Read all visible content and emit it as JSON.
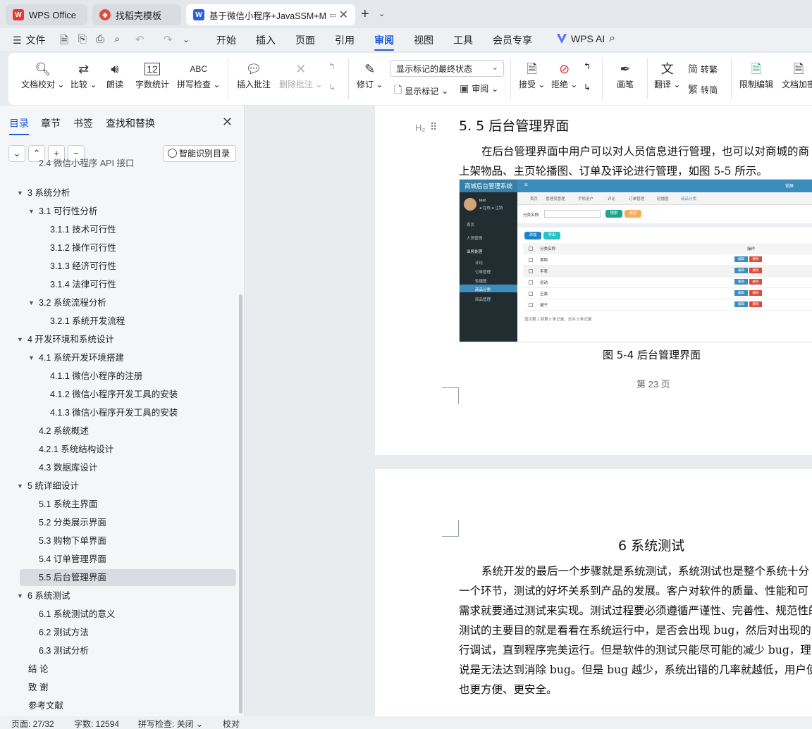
{
  "tabs": [
    {
      "label": "WPS Office",
      "icon": "wps-logo-icon"
    },
    {
      "label": "找稻壳模板",
      "icon": "docer-icon"
    },
    {
      "label": "基于微信小程序+JavaSSM+M",
      "icon": "word-doc-icon",
      "active": true
    }
  ],
  "menu": {
    "file": "文件",
    "tabs": [
      "开始",
      "插入",
      "页面",
      "引用",
      "审阅",
      "视图",
      "工具",
      "会员专享"
    ],
    "active_tab": "审阅",
    "wps_ai": "WPS AI"
  },
  "ribbon": {
    "proofread": "文档校对",
    "compare": "比较",
    "read_aloud": "朗读",
    "word_count": "字数统计",
    "spell_check": "拼写检查",
    "spell_check_icon_text": "ABC",
    "word_count_icon_text": "12",
    "insert_comment": "插入批注",
    "delete_comment": "删除批注",
    "track_changes": "修订",
    "markup_mode": "显示标记的最终状态",
    "show_markup": "显示标记",
    "review": "审阅",
    "accept": "接受",
    "reject": "拒绝",
    "ink": "画笔",
    "translate": "翻译",
    "trad_convert": "转繁",
    "simp_convert": "转简",
    "restrict_edit": "限制编辑",
    "doc_encrypt": "文档加密"
  },
  "sidebar": {
    "tabs": [
      "目录",
      "章节",
      "书签",
      "查找和替换"
    ],
    "active_tab": "目录",
    "smart_toc": "智能识别目录",
    "items": [
      {
        "label": "2.4 微信小程序 API 接口",
        "level": 2
      },
      {
        "label": "3  系统分析",
        "level": 1,
        "expanded": true
      },
      {
        "label": "3.1  可行性分析",
        "level": 2,
        "expanded": true
      },
      {
        "label": "3.1.1  技术可行性",
        "level": 3
      },
      {
        "label": "3.1.2 操作可行性",
        "level": 3
      },
      {
        "label": "3.1.3  经济可行性",
        "level": 3
      },
      {
        "label": "3.1.4  法律可行性",
        "level": 3
      },
      {
        "label": "3.2 系统流程分析",
        "level": 2,
        "expanded": true
      },
      {
        "label": "3.2.1 系统开发流程",
        "level": 3
      },
      {
        "label": "4  开发环境和系统设计",
        "level": 1,
        "expanded": true
      },
      {
        "label": "4.1 系统开发环境搭建",
        "level": 2,
        "expanded": true
      },
      {
        "label": "4.1.1    微信小程序的注册",
        "level": 3
      },
      {
        "label": "4.1.2  微信小程序开发工具的安装",
        "level": 3
      },
      {
        "label": "4.1.3  微信小程序开发工具的安装",
        "level": 3
      },
      {
        "label": "4.2  系统概述",
        "level": 2
      },
      {
        "label": "4.2.1  系统结构设计",
        "level": 2
      },
      {
        "label": "4.3 数据库设计",
        "level": 2
      },
      {
        "label": "5 统详细设计",
        "level": 1,
        "expanded": true
      },
      {
        "label": "5.1 系统主界面",
        "level": 2
      },
      {
        "label": "5.2 分类展示界面",
        "level": 2
      },
      {
        "label": "5.3 购物下单界面",
        "level": 2
      },
      {
        "label": "5.4 订单管理界面",
        "level": 2
      },
      {
        "label": "5.5 后台管理界面",
        "level": 2,
        "selected": true
      },
      {
        "label": "6 系统测试",
        "level": 1,
        "expanded": true
      },
      {
        "label": "6.1 系统测试的意义",
        "level": 2
      },
      {
        "label": "6.2  测试方法",
        "level": 2
      },
      {
        "label": "6.3 测试分析",
        "level": 2
      },
      {
        "label": "结      论",
        "level": 0
      },
      {
        "label": "致      谢",
        "level": 0
      },
      {
        "label": "参考文献",
        "level": 0
      }
    ]
  },
  "document": {
    "h2_marker": "H₂",
    "section_heading": "5. 5 后台管理界面",
    "para1": [
      "在后台管理界面中用户可以对人员信息进行管理，也可以对商城的商",
      "上架物品、主页轮播图、订单及评论进行管理，如图 5-5 所示。"
    ],
    "figure_caption": "图 5-4  后台管理界面",
    "page_number": "第 23 页",
    "chapter_title": "6 系统测试",
    "para2": [
      "系统开发的最后一个步骤就是系统测试，系统测试也是整个系统十分",
      "一个环节，测试的好坏关系到产品的发展。客户对软件的质量、性能和可",
      "需求就要通过测试来实现。测试过程要必须遵循严谨性、完善性、规范性的",
      "测试的主要目的就是看看在系统运行中，是否会出现 bug，然后对出现的",
      "行调试，直到程序完美运行。但是软件的测试只能尽可能的减少 bug，理",
      "说是无法达到消除 bug。但是 bug 越少，系统出错的几率就越低，用户使",
      "也更方便、更安全。"
    ]
  },
  "figure": {
    "title": "商城后台管理系统",
    "user": "test",
    "online": "在线",
    "logout": "注销",
    "header_right": "锁屏",
    "side_items": [
      "首页",
      "人员管理",
      "业务处理",
      "评论",
      "订单管理",
      "轮播图",
      "商品分类",
      "商品管理"
    ],
    "side_active": "商品分类",
    "tabs": [
      "首页",
      "管理员管理",
      "手机用户",
      "评论",
      "订单管理",
      "轮播图",
      "商品分类"
    ],
    "search_label": "分类名称:",
    "search_btn": "搜索",
    "reset_btn": "清空",
    "add_btn": "添加",
    "export_btn": "导出",
    "col_name": "分类名称",
    "col_action": "操作",
    "rows": [
      "食物",
      "手表",
      "运动",
      "正装",
      "裙子"
    ],
    "edit": "编辑",
    "delete": "删除",
    "footer": "显示第 1 到第 5 条记录，总共 5 条记录"
  },
  "status": {
    "page": "页面: 27/32",
    "words": "字数: 12594",
    "spell": "拼写检查: 关闭",
    "proof": "校对"
  }
}
